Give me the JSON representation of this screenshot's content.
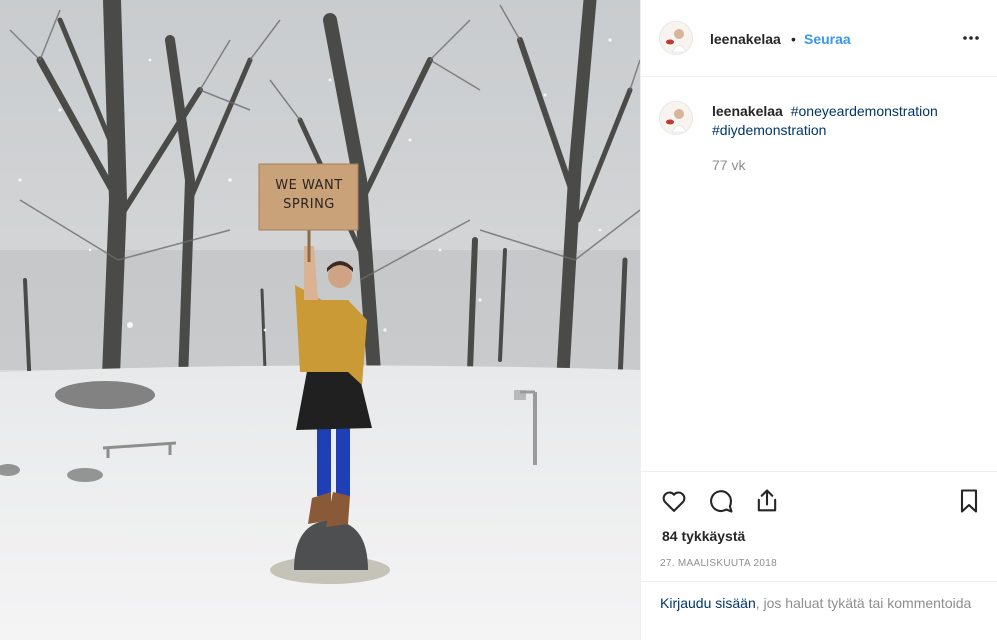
{
  "post": {
    "image_alt_icon": "snow-park-photo",
    "sign_text_line1": "WE WANT",
    "sign_text_line2": "SPRING"
  },
  "header": {
    "username": "leenakelaa",
    "separator": "•",
    "follow_label": "Seuraa",
    "more_icon": "more-horizontal-icon"
  },
  "caption": {
    "username": "leenakelaa",
    "hashtags": [
      "#oneyeardemonstration",
      "#diydemonstration"
    ],
    "age": "77 vk"
  },
  "actions": {
    "icons": [
      "heart-icon",
      "comment-icon",
      "share-icon",
      "bookmark-icon"
    ],
    "likes": "84 tykkäystä",
    "date": "27. MAALISKUUTA 2018"
  },
  "login": {
    "link_label": "Kirjaudu sisään",
    "rest": ", jos haluat tykätä tai kommentoida"
  },
  "colors": {
    "link_blue": "#3897f0",
    "hashtag_blue": "#003569",
    "muted": "#8e8e8e",
    "border": "#efefef"
  }
}
